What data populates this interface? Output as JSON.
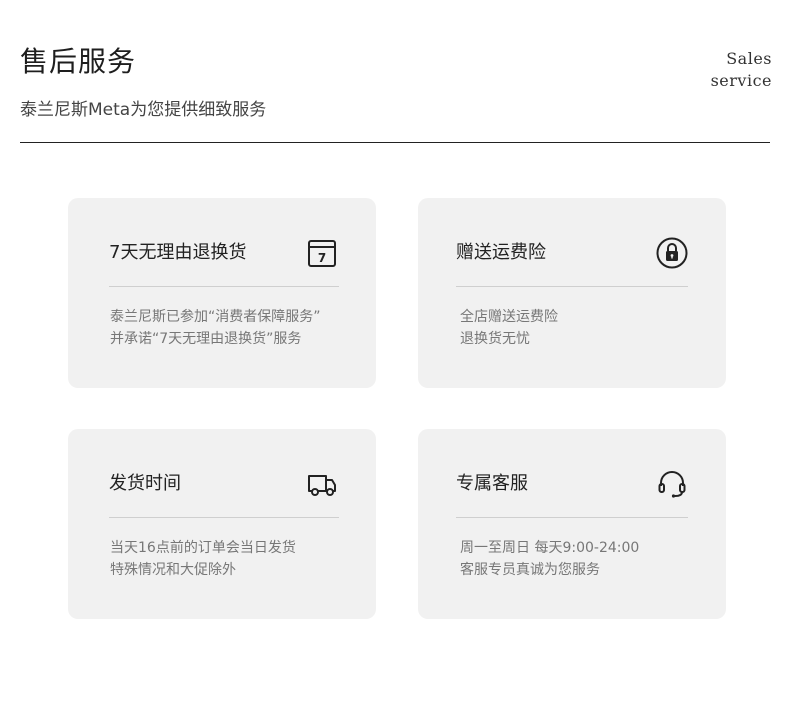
{
  "header": {
    "title": "售后服务",
    "subtitle": "泰兰尼斯Meta为您提供细致服务",
    "en_line1": "Sales",
    "en_line2": "service"
  },
  "cards": [
    {
      "title": "7天无理由退换货",
      "icon": "calendar-seven-icon",
      "icon_text": "7",
      "lines": [
        "泰兰尼斯已参加“消费者保障服务”",
        "并承诺“7天无理由退换货”服务"
      ]
    },
    {
      "title": "赠送运费险",
      "icon": "lock-icon",
      "lines": [
        "全店赠送运费险",
        "退换货无忧"
      ]
    },
    {
      "title": "发货时间",
      "icon": "delivery-truck-icon",
      "lines": [
        "当天16点前的订单会当日发货",
        "特殊情况和大促除外"
      ]
    },
    {
      "title": "专属客服",
      "icon": "headset-icon",
      "lines": [
        "周一至周日  每天9:00-24:00",
        "客服专员真诚为您服务"
      ]
    }
  ],
  "colors": {
    "card_background": "#f1f1f1",
    "rule": "#222222",
    "description_text": "#777777"
  }
}
